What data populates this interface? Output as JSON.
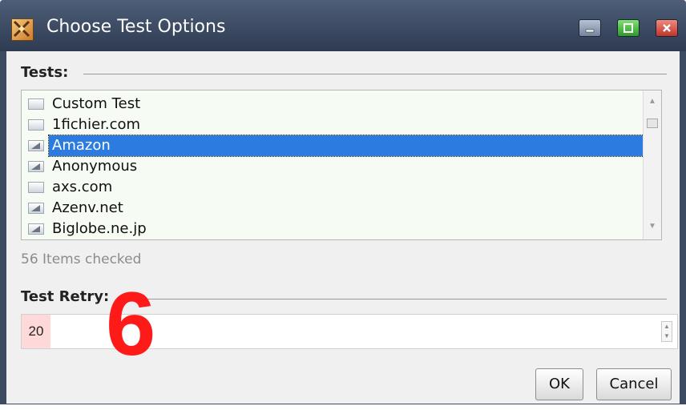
{
  "window": {
    "title": "Choose Test Options",
    "app_icon": "swords-icon",
    "controls": [
      "minimize-icon",
      "maximize-icon",
      "close-icon"
    ]
  },
  "tests_group": {
    "label": "Tests:",
    "items": [
      {
        "label": "Custom Test",
        "checked": false,
        "selected": false
      },
      {
        "label": "1fichier.com",
        "checked": false,
        "selected": false
      },
      {
        "label": "Amazon",
        "checked": true,
        "selected": true
      },
      {
        "label": "Anonymous",
        "checked": true,
        "selected": false
      },
      {
        "label": "axs.com",
        "checked": false,
        "selected": false
      },
      {
        "label": "Azenv.net",
        "checked": true,
        "selected": false
      },
      {
        "label": "Biglobe.ne.jp",
        "checked": true,
        "selected": false
      }
    ],
    "status": "56 Items checked"
  },
  "retry_group": {
    "label": "Test Retry:",
    "value": "20"
  },
  "overlay": {
    "number": "6",
    "color": "#ff1a1a"
  },
  "buttons": {
    "ok": "OK",
    "cancel": "Cancel"
  },
  "colors": {
    "titlebar": "#3d4b60",
    "selection": "#2b7be0",
    "list_bg": "#f6fbf3"
  }
}
